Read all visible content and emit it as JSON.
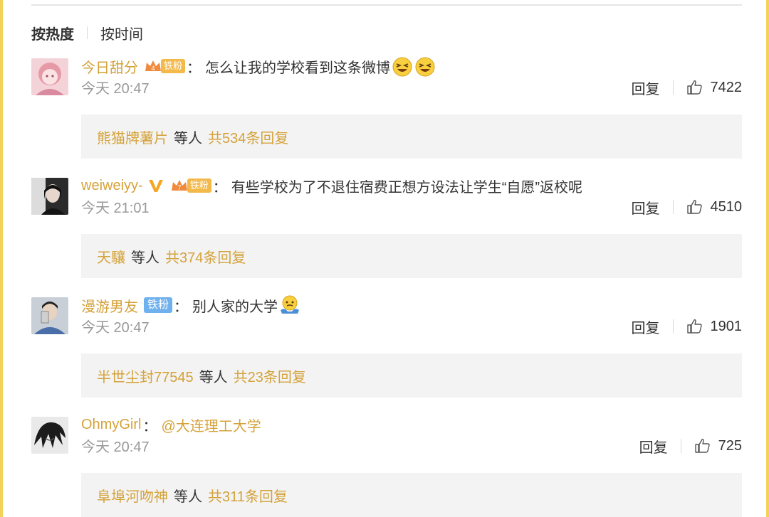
{
  "sort": {
    "hot_label": "按热度",
    "time_label": "按时间"
  },
  "comments": [
    {
      "username": "今日甜分",
      "badge": "铁粉",
      "badge_level": "4",
      "text": "怎么让我的学校看到这条微博",
      "emojis": [
        "grin-squint-emoji",
        "grin-squint-emoji"
      ],
      "time": "今天 20:47",
      "reply_label": "回复",
      "likes": "7422",
      "reply_user": "熊猫牌薯片",
      "reply_mid": "等人",
      "reply_count": "共534条回复"
    },
    {
      "username": "weiweiyy-",
      "badge": "铁粉",
      "badge_level": "7",
      "text": "有些学校为了不退住宿费正想方设法让学生“自愿”返校呢",
      "time": "今天 21:01",
      "reply_label": "回复",
      "likes": "4510",
      "reply_user": "天驤",
      "reply_mid": "等人",
      "reply_count": "共374条回复"
    },
    {
      "username": "漫游男友",
      "badge": "铁粉",
      "text": "别人家的大学",
      "emojis": [
        "shrug-emoji"
      ],
      "time": "今天 20:47",
      "reply_label": "回复",
      "likes": "1901",
      "reply_user": "半世尘封77545",
      "reply_mid": "等人",
      "reply_count": "共23条回复"
    },
    {
      "username": "OhmyGirl",
      "text": "@大连理工大学",
      "time": "今天 20:47",
      "reply_label": "回复",
      "likes": "725",
      "reply_user": "阜埠河吻神",
      "reply_mid": "等人",
      "reply_count": "共311条回复"
    }
  ],
  "colors": {
    "username": "#d4a23a",
    "reply_bg": "#f3f3f3",
    "badge_orange": "#f3b94a",
    "badge_blue": "#6fb1ef",
    "frame": "#f3d15a"
  }
}
